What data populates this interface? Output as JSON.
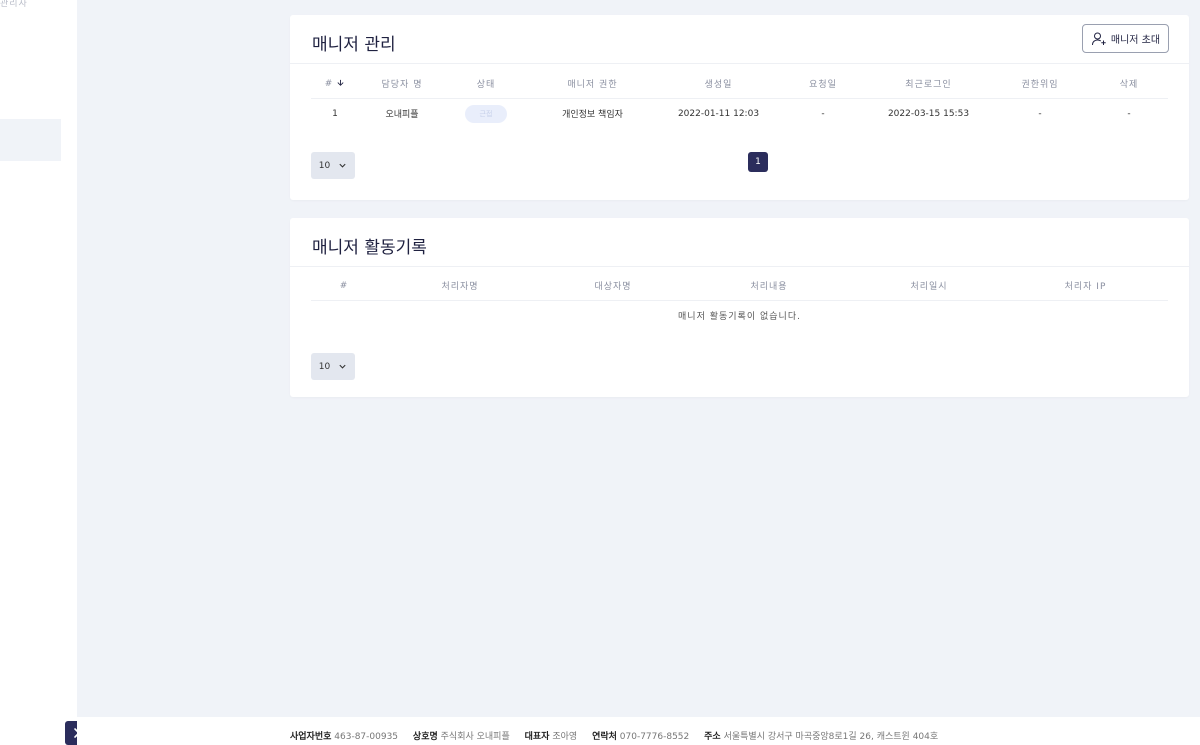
{
  "sidebar": {
    "top_text": "관리자",
    "toggle_icon": "chevron-right-icon"
  },
  "manager_card": {
    "title": "매니저 관리",
    "invite_label": "매니저 초대",
    "columns": [
      "#",
      "담당자 명",
      "상태",
      "매니저 권한",
      "생성일",
      "요청일",
      "최근로그인",
      "권한위임",
      "삭제"
    ],
    "rows": [
      {
        "no": "1",
        "name": "오내피플",
        "status": "근접",
        "role": "개인정보 책임자",
        "created": "2022-01-11 12:03",
        "requested": "-",
        "last_login": "2022-03-15 15:53",
        "delegate": "-",
        "delete": "-"
      }
    ],
    "page_size": "10",
    "current_page": "1"
  },
  "activity_card": {
    "title": "매니저 활동기록",
    "columns": [
      "#",
      "처리자명",
      "대상자명",
      "처리내용",
      "처리일시",
      "처리자 IP"
    ],
    "empty_message": "매니저 활동기록이 없습니다.",
    "page_size": "10"
  },
  "footer": {
    "biz_no_label": "사업자번호",
    "biz_no": "463-87-00935",
    "company_label": "상호명",
    "company": "주식회사 오내피플",
    "ceo_label": "대표자",
    "ceo": "조아영",
    "contact_label": "연락처",
    "contact": "070-7776-8552",
    "address_label": "주소",
    "address": "서울특별시 강서구 마곡중앙8로1길 26, 캐스트윈 404호"
  },
  "colors": {
    "accent": "#2b2d5c",
    "background": "#f0f3f8",
    "card": "#ffffff"
  }
}
